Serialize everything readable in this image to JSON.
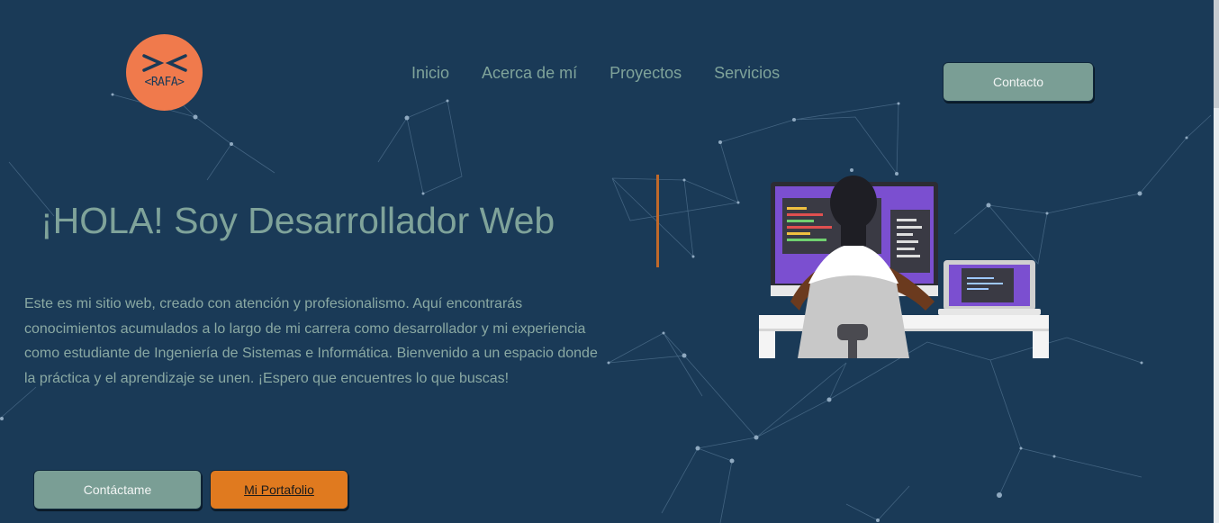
{
  "logo": {
    "text": "<RAFA>",
    "mark": "><"
  },
  "nav": {
    "items": [
      "Inicio",
      "Acerca de mí",
      "Proyectos",
      "Servicios"
    ]
  },
  "header": {
    "contact_label": "Contacto"
  },
  "hero": {
    "title": "¡HOLA! Soy Desarrollador Web",
    "description": "Este es mi sitio web, creado con atención y profesionalismo. Aquí encontrarás conocimientos acumulados a lo largo de mi carrera como desarrollador y mi experiencia como estudiante de Ingeniería de Sistemas e Informática. Bienvenido a un espacio donde la práctica y el aprendizaje se unen. ¡Espero que encuentres lo que buscas!",
    "cta_label": "Contáctame",
    "portfolio_label": "Mi Portafolio"
  },
  "colors": {
    "background": "#1a3a57",
    "accent_green": "#7a9e95",
    "accent_orange": "#e07a1f",
    "logo_orange": "#f07a4c",
    "text": "#7fa39a"
  },
  "icons": {
    "logo": "rafa-logo-icon",
    "illustration": "developer-at-desk-illustration"
  }
}
